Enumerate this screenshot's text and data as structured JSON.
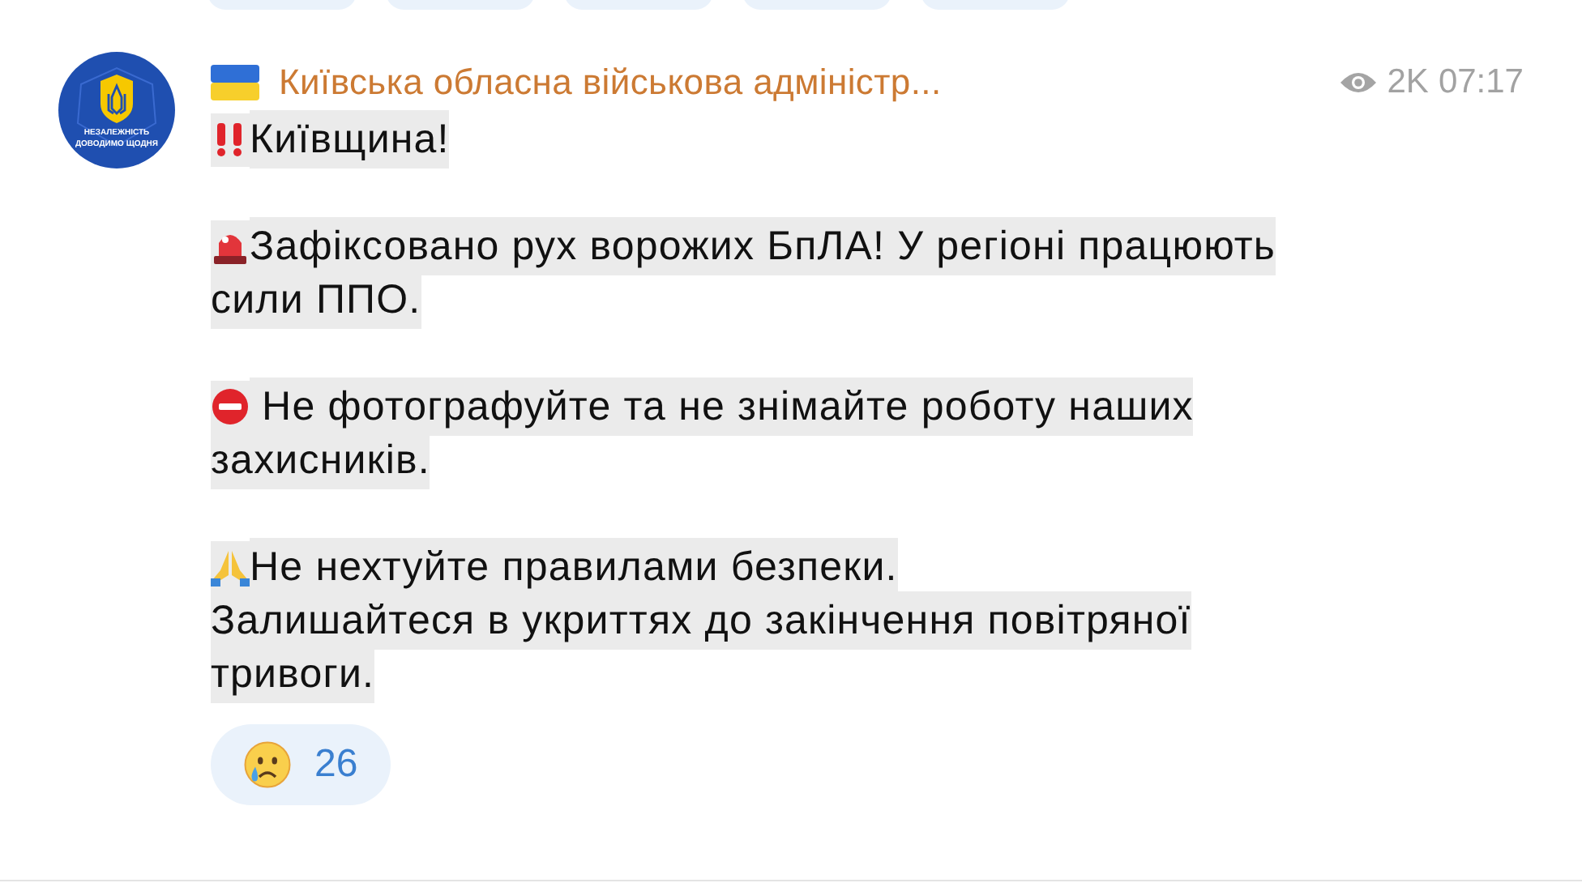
{
  "previous_reactions": [
    {
      "kind": "pill"
    },
    {
      "kind": "pill"
    },
    {
      "kind": "pill"
    },
    {
      "kind": "pill"
    },
    {
      "kind": "pill"
    }
  ],
  "message": {
    "avatar": {
      "lines": [
        "НЕЗАЛЕЖНІСТЬ",
        "ДОВОДИМО ЩОДНЯ"
      ]
    },
    "channel": "Київська обласна військова адміністр...",
    "views": "2K",
    "time": "07:17",
    "paragraphs": [
      {
        "kind": "double-exclamation",
        "lines": [
          "Київщина!"
        ]
      },
      {
        "kind": "siren",
        "lines": [
          "Зафіксовано рух ворожих БпЛА! У регіоні працюють",
          "сили ППО."
        ]
      },
      {
        "kind": "no-entry",
        "lines": [
          " Не фотографуйте та не знімайте роботу наших",
          "захисників."
        ]
      },
      {
        "kind": "pray",
        "lines": [
          "Не нехтуйте правилами безпеки.",
          "Залишайтеся в укриттях до закінчення повітряної",
          "тривоги."
        ]
      }
    ],
    "reactions": [
      {
        "kind": "crying",
        "count": "26"
      }
    ]
  }
}
